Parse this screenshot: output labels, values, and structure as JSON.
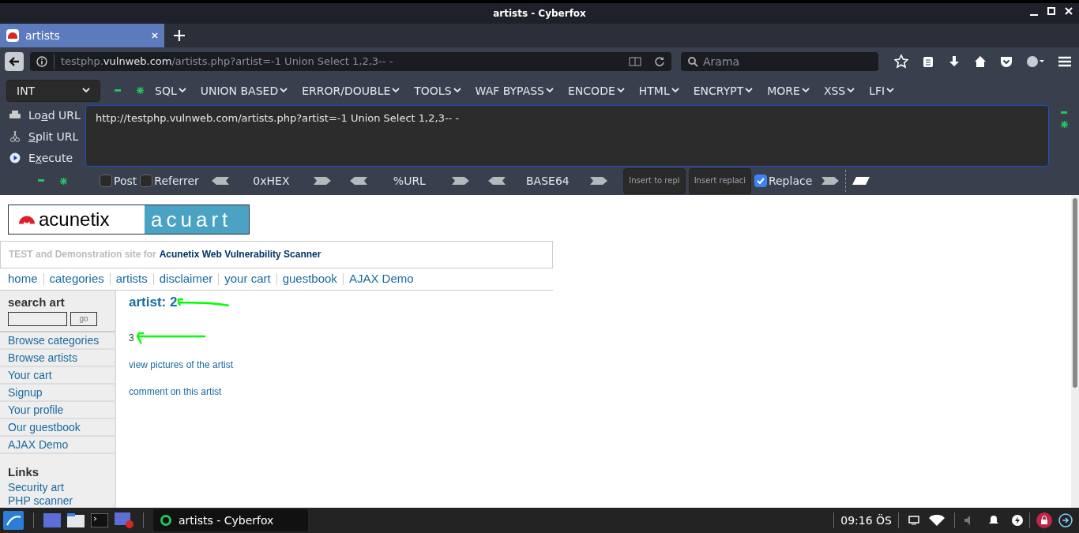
{
  "window": {
    "title": "artists - Cyberfox"
  },
  "tabs": [
    {
      "label": "artists",
      "selected": true
    }
  ],
  "address_bar": {
    "host_prefix": "testphp.",
    "host": "vulnweb.com",
    "path": "/artists.php?artist=-1 Union Select 1,2,3-- -"
  },
  "search": {
    "placeholder": "Arama"
  },
  "hackbar": {
    "type_select": "INT",
    "menus": [
      "SQL",
      "UNION BASED",
      "ERROR/DOUBLE",
      "TOOLS",
      "WAF BYPASS",
      "ENCODE",
      "HTML",
      "ENCRYPT",
      "MORE",
      "XSS",
      "LFI"
    ],
    "actions": [
      {
        "kind": "load",
        "before": "Lo",
        "key": "a",
        "after": "d URL"
      },
      {
        "kind": "split",
        "key": "S",
        "after": "plit URL"
      },
      {
        "kind": "execute",
        "before": "E",
        "key": "x",
        "after": "ecute"
      }
    ],
    "url_value": "http://testphp.vulnweb.com/artists.php?artist=-1 Union Select 1,2,3-- -",
    "options": [
      {
        "label": "Post",
        "checked": false
      },
      {
        "label": "Referrer",
        "checked": false
      }
    ],
    "encoders": [
      "0xHEX",
      "%URL",
      "BASE64"
    ],
    "insert_buttons": [
      "Insert to repl",
      "Insert replaci"
    ],
    "replace": {
      "label": "Replace",
      "checked": true
    }
  },
  "page": {
    "logo_left": "acunetix",
    "logo_right": "acuart",
    "tagline_prefix": "TEST and Demonstration site for",
    "tagline_link": "Acunetix Web Vulnerability Scanner",
    "nav": [
      "home",
      "categories",
      "artists",
      "disclaimer",
      "your cart",
      "guestbook",
      "AJAX Demo"
    ],
    "sidebar": {
      "search_title": "search art",
      "go_label": "go",
      "items": [
        "Browse categories",
        "Browse artists",
        "Your cart",
        "Signup",
        "Your profile",
        "Our guestbook",
        "AJAX Demo"
      ],
      "links_title": "Links",
      "links": [
        "Security art",
        "PHP scanner"
      ]
    },
    "main": {
      "heading": "artist: 2",
      "body": "3",
      "links": [
        "view pictures of the artist",
        "comment on this artist"
      ]
    }
  },
  "taskbar": {
    "task": "artists - Cyberfox",
    "clock": "09:16 ÖS"
  }
}
